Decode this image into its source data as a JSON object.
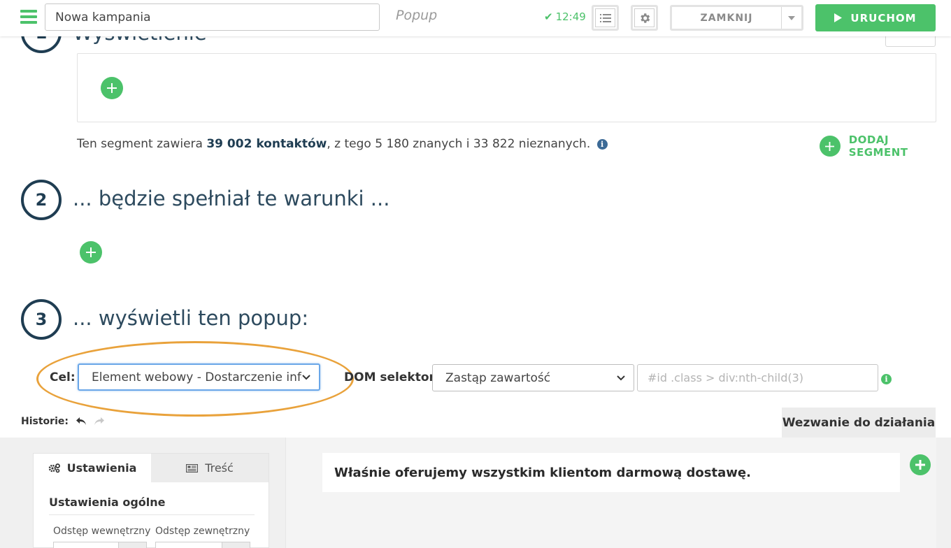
{
  "topbar": {
    "campaign_name": "Nowa kampania",
    "campaign_type": "Popup",
    "save_time": "12:49",
    "close_label": "ZAMKNIJ",
    "run_label": "URUCHOM"
  },
  "step1": {
    "number": "1",
    "title": "Wyświetlenie",
    "segment_text_prefix": "Ten segment zawiera ",
    "segment_contacts": "39 002 kontaktów",
    "segment_text_suffix": ", z tego 5 180 znanych i 33 822 nieznanych.",
    "add_segment_label": "DODAJ SEGMENT"
  },
  "step2": {
    "number": "2",
    "title": "... będzie spełniał te warunki ..."
  },
  "step3": {
    "number": "3",
    "title": "... wyświetli ten popup:",
    "goal_label": "Cel:",
    "goal_value": "Element webowy - Dostarczenie informacji",
    "dom_label": "DOM selektor:",
    "dom_mode_value": "Zastąp zawartość",
    "dom_selector_placeholder": "#id .class > div:nth-child(3)"
  },
  "history": {
    "label": "Historie:"
  },
  "editor": {
    "cta_tab": "Wezwanie do działania",
    "tab_settings": "Ustawienia",
    "tab_content": "Treść",
    "section_heading": "Ustawienia ogólne",
    "padding_inner_label": "Odstęp wewnętrzny",
    "padding_outer_label": "Odstęp zewnętrzny",
    "canvas_text": "Właśnie oferujemy wszystkim klientom darmową dostawę."
  },
  "colors": {
    "accent_green": "#4cc26a",
    "dark_blue": "#1f3d52",
    "highlight_orange": "#e9a23b"
  }
}
